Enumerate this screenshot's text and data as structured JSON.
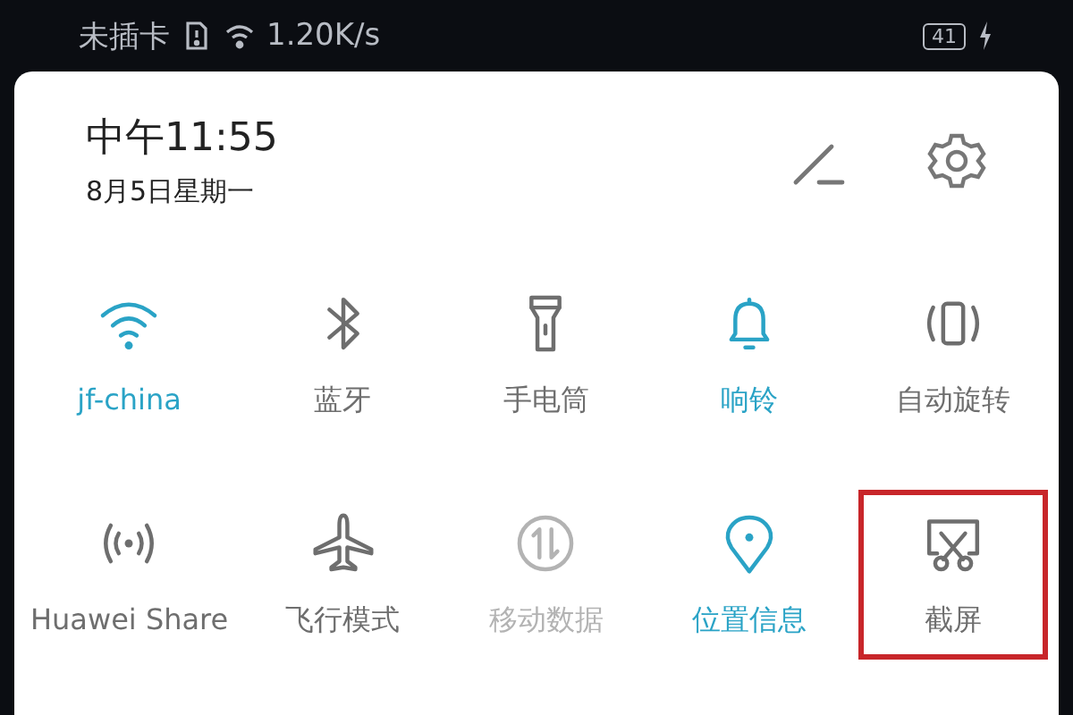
{
  "status_bar": {
    "carrier": "未插卡",
    "speed": "1.20K/s",
    "battery": "41"
  },
  "header": {
    "time": "中午11:55",
    "date": "8月5日星期一"
  },
  "tiles": [
    {
      "kind": "wifi",
      "label": "jf-china",
      "on": true,
      "disabled": false,
      "highlighted": false
    },
    {
      "kind": "bluetooth",
      "label": "蓝牙",
      "on": false,
      "disabled": false,
      "highlighted": false
    },
    {
      "kind": "flashlight",
      "label": "手电筒",
      "on": false,
      "disabled": false,
      "highlighted": false
    },
    {
      "kind": "bell",
      "label": "响铃",
      "on": true,
      "disabled": false,
      "highlighted": false
    },
    {
      "kind": "rotate",
      "label": "自动旋转",
      "on": false,
      "disabled": false,
      "highlighted": false
    },
    {
      "kind": "share",
      "label": "Huawei Share",
      "on": false,
      "disabled": false,
      "highlighted": false
    },
    {
      "kind": "airplane",
      "label": "飞行模式",
      "on": false,
      "disabled": false,
      "highlighted": false
    },
    {
      "kind": "data",
      "label": "移动数据",
      "on": false,
      "disabled": true,
      "highlighted": false
    },
    {
      "kind": "location",
      "label": "位置信息",
      "on": true,
      "disabled": false,
      "highlighted": false
    },
    {
      "kind": "screenshot",
      "label": "截屏",
      "on": false,
      "disabled": false,
      "highlighted": true
    }
  ]
}
